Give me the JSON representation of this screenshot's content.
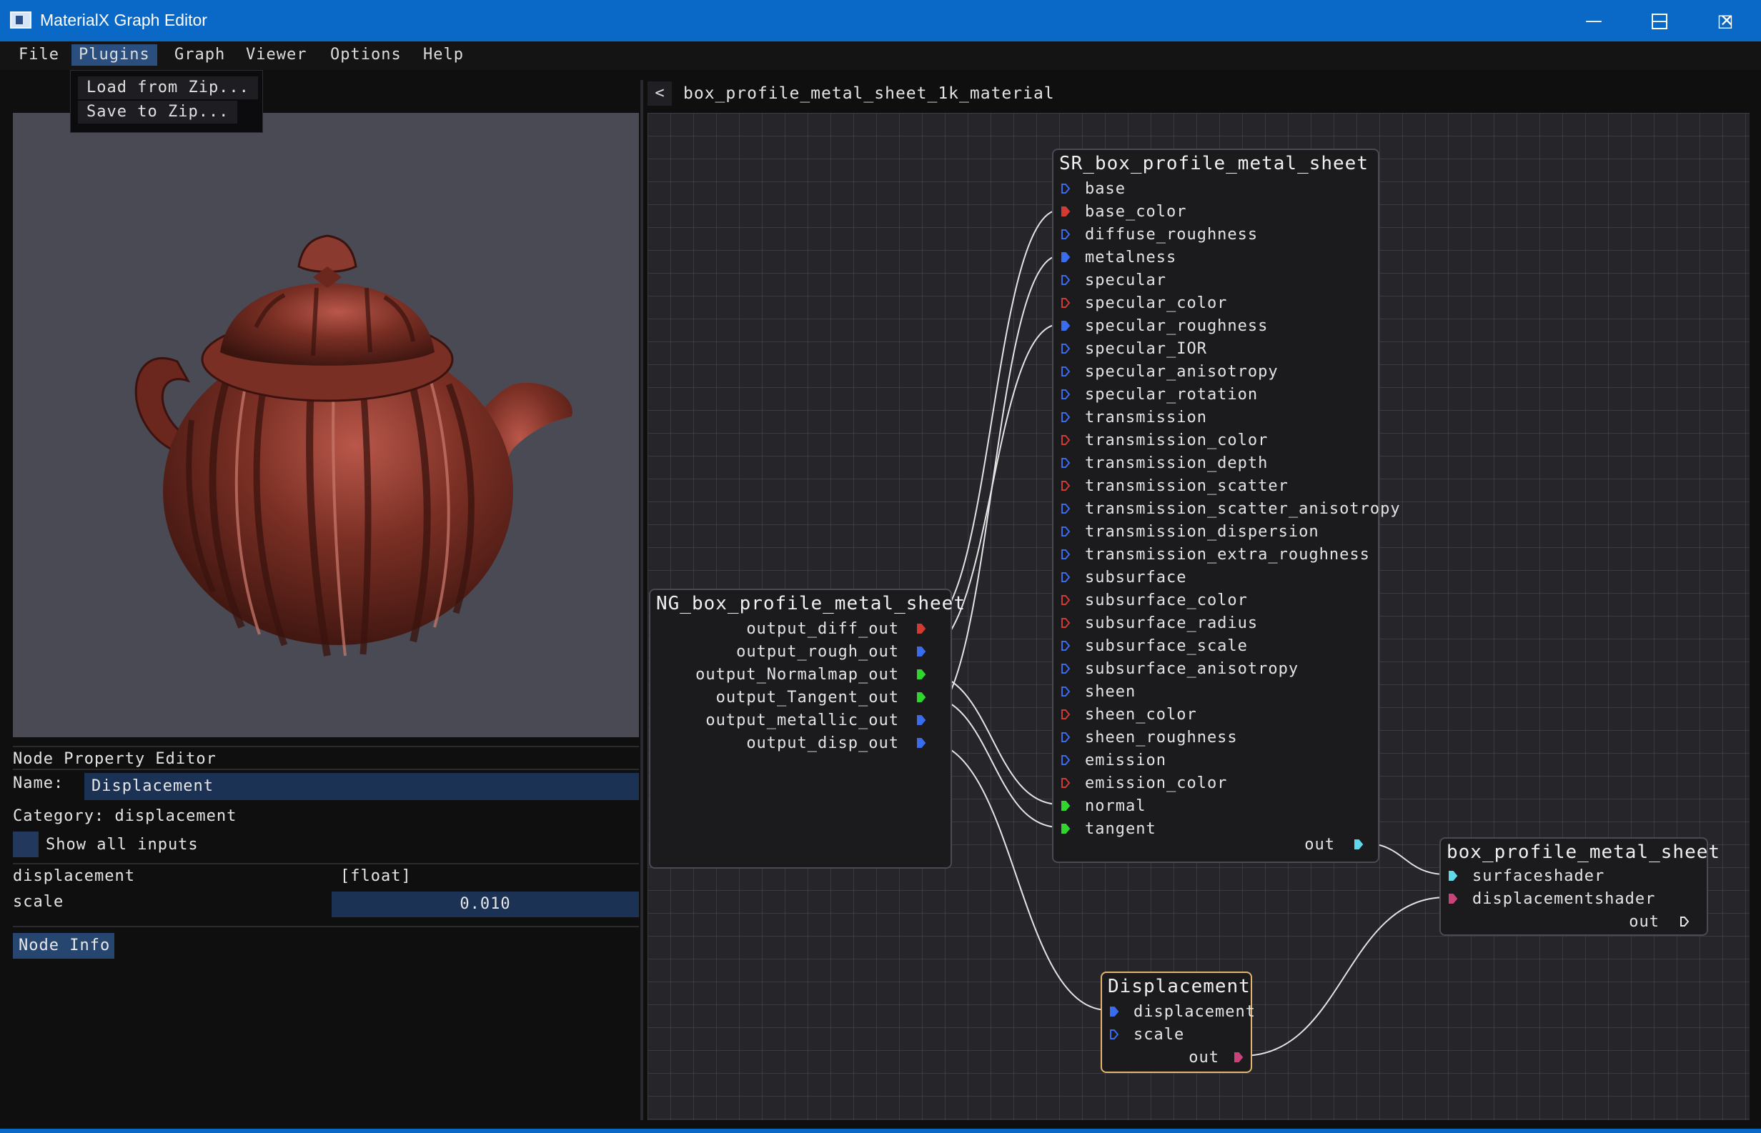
{
  "window": {
    "title": "MaterialX Graph Editor",
    "minimize_icon": "minimize-icon",
    "maximize_icon": "maximize-icon",
    "close_icon": "close-icon"
  },
  "menu": {
    "items": [
      "File",
      "Plugins",
      "Graph",
      "Viewer",
      "Options",
      "Help"
    ],
    "active": "Plugins"
  },
  "plugins_menu": {
    "items": [
      "Load from Zip...",
      "Save to Zip..."
    ]
  },
  "viewer": {
    "object": "teapot",
    "material_color": "#7a2f24"
  },
  "property_editor": {
    "title": "Node Property Editor",
    "name_label": "Name:",
    "name_value": "Displacement",
    "category_text": "Category: displacement",
    "show_all_label": "Show all inputs",
    "rows": [
      {
        "label": "displacement",
        "value": "[float]"
      },
      {
        "label": "scale",
        "value": "0.010"
      }
    ],
    "node_info_label": "Node Info"
  },
  "graph": {
    "back_label": "<",
    "title": "box_profile_metal_sheet_1k_material",
    "nodes": {
      "sr": {
        "title": "SR_box_profile_metal_sheet",
        "inputs": [
          {
            "name": "base",
            "type": "float",
            "connected": false
          },
          {
            "name": "base_color",
            "type": "color",
            "connected": true
          },
          {
            "name": "diffuse_roughness",
            "type": "float",
            "connected": false
          },
          {
            "name": "metalness",
            "type": "float",
            "connected": true
          },
          {
            "name": "specular",
            "type": "float",
            "connected": false
          },
          {
            "name": "specular_color",
            "type": "color",
            "connected": false
          },
          {
            "name": "specular_roughness",
            "type": "float",
            "connected": true
          },
          {
            "name": "specular_IOR",
            "type": "float",
            "connected": false
          },
          {
            "name": "specular_anisotropy",
            "type": "float",
            "connected": false
          },
          {
            "name": "specular_rotation",
            "type": "float",
            "connected": false
          },
          {
            "name": "transmission",
            "type": "float",
            "connected": false
          },
          {
            "name": "transmission_color",
            "type": "color",
            "connected": false
          },
          {
            "name": "transmission_depth",
            "type": "float",
            "connected": false
          },
          {
            "name": "transmission_scatter",
            "type": "color",
            "connected": false
          },
          {
            "name": "transmission_scatter_anisotropy",
            "type": "float",
            "connected": false
          },
          {
            "name": "transmission_dispersion",
            "type": "float",
            "connected": false
          },
          {
            "name": "transmission_extra_roughness",
            "type": "float",
            "connected": false
          },
          {
            "name": "subsurface",
            "type": "float",
            "connected": false
          },
          {
            "name": "subsurface_color",
            "type": "color",
            "connected": false
          },
          {
            "name": "subsurface_radius",
            "type": "color",
            "connected": false
          },
          {
            "name": "subsurface_scale",
            "type": "float",
            "connected": false
          },
          {
            "name": "subsurface_anisotropy",
            "type": "float",
            "connected": false
          },
          {
            "name": "sheen",
            "type": "float",
            "connected": false
          },
          {
            "name": "sheen_color",
            "type": "color",
            "connected": false
          },
          {
            "name": "sheen_roughness",
            "type": "float",
            "connected": false
          },
          {
            "name": "emission",
            "type": "float",
            "connected": false
          },
          {
            "name": "emission_color",
            "type": "color",
            "connected": false
          },
          {
            "name": "normal",
            "type": "vector",
            "connected": true
          },
          {
            "name": "tangent",
            "type": "vector",
            "connected": true
          }
        ],
        "output": "out"
      },
      "ng": {
        "title": "NG_box_profile_metal_sheet",
        "outputs": [
          {
            "name": "output_diff_out",
            "type": "color"
          },
          {
            "name": "output_rough_out",
            "type": "float"
          },
          {
            "name": "output_Normalmap_out",
            "type": "vector"
          },
          {
            "name": "output_Tangent_out",
            "type": "vector"
          },
          {
            "name": "output_metallic_out",
            "type": "float"
          },
          {
            "name": "output_disp_out",
            "type": "float"
          }
        ]
      },
      "mat": {
        "title": "box_profile_metal_sheet",
        "inputs": [
          {
            "name": "surfaceshader",
            "type": "surface"
          },
          {
            "name": "displacementshader",
            "type": "displacement"
          }
        ],
        "output": "out"
      },
      "disp": {
        "title": "Displacement",
        "inputs": [
          {
            "name": "displacement",
            "type": "float",
            "connected": true
          },
          {
            "name": "scale",
            "type": "float",
            "connected": false
          }
        ],
        "output": "out"
      }
    },
    "pin_colors": {
      "float": "#3a6cf0",
      "color": "#d23a32",
      "vector": "#2ed62e",
      "surface": "#5fd8ea",
      "displacement": "#c8437a"
    }
  }
}
